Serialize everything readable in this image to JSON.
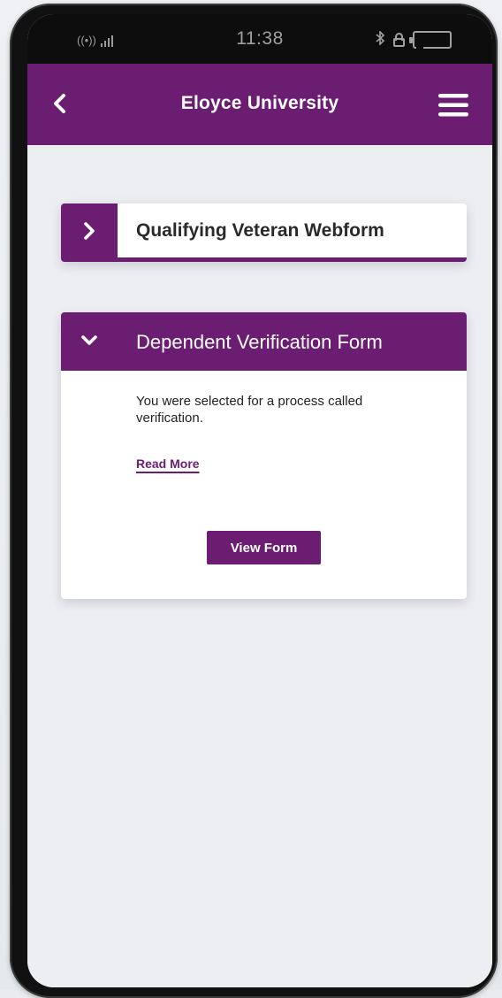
{
  "status_bar": {
    "time": "11:38",
    "radio_glyph": "((•))",
    "icons": [
      "radio-icon",
      "signal-icon",
      "bluetooth-icon",
      "lock-icon",
      "battery-icon"
    ]
  },
  "header": {
    "title": "Eloyce University",
    "back_icon": "chevron-left-icon",
    "menu_icon": "hamburger-menu-icon"
  },
  "forms": [
    {
      "title": "Qualifying Veteran Webform",
      "expanded": false,
      "toggle_icon": "chevron-right-icon"
    },
    {
      "title": "Dependent Verification Form",
      "expanded": true,
      "toggle_icon": "chevron-down-icon",
      "description": "You were selected for a process called verification.",
      "read_more_label": "Read More",
      "view_button_label": "View Form"
    }
  ],
  "colors": {
    "brand": "#6b1d72",
    "background": "#eceef2",
    "card": "#ffffff",
    "status_bar": "#0d0d0d"
  }
}
